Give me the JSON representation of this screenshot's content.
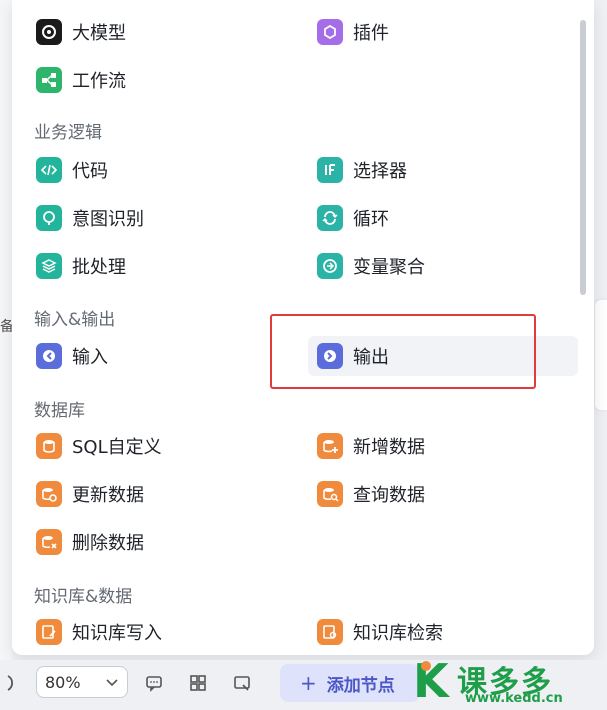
{
  "background": {
    "left_clipped_text": "备"
  },
  "menu": {
    "top_items": [
      {
        "label": "大模型",
        "icon": "llm-icon"
      },
      {
        "label": "插件",
        "icon": "plugin-icon"
      },
      {
        "label": "工作流",
        "icon": "workflow-icon"
      }
    ],
    "sections": {
      "business_logic": {
        "title": "业务逻辑",
        "items": [
          {
            "label": "代码",
            "icon": "code-icon"
          },
          {
            "label": "选择器",
            "icon": "if-selector-icon"
          },
          {
            "label": "意图识别",
            "icon": "intent-icon"
          },
          {
            "label": "循环",
            "icon": "loop-icon"
          },
          {
            "label": "批处理",
            "icon": "batch-icon"
          },
          {
            "label": "变量聚合",
            "icon": "variable-merge-icon"
          }
        ]
      },
      "io": {
        "title": "输入&输出",
        "items": [
          {
            "label": "输入",
            "icon": "input-icon"
          },
          {
            "label": "输出",
            "icon": "output-icon"
          }
        ]
      },
      "database": {
        "title": "数据库",
        "items": [
          {
            "label": "SQL自定义",
            "icon": "sql-icon"
          },
          {
            "label": "新增数据",
            "icon": "db-add-icon"
          },
          {
            "label": "更新数据",
            "icon": "db-update-icon"
          },
          {
            "label": "查询数据",
            "icon": "db-query-icon"
          },
          {
            "label": "删除数据",
            "icon": "db-delete-icon"
          }
        ]
      },
      "knowledge": {
        "title": "知识库&数据",
        "items": [
          {
            "label": "知识库写入",
            "icon": "kb-write-icon"
          },
          {
            "label": "知识库检索",
            "icon": "kb-search-icon"
          }
        ]
      }
    },
    "colors": {
      "highlight_border": "#e23b3b",
      "green": "#2db56c",
      "purple": "#a56ee8",
      "indigo": "#5b6cdb",
      "orange": "#f08b3d"
    }
  },
  "toolbar": {
    "zoom_value": "80%",
    "add_node_label": "添加节点"
  },
  "watermark": {
    "brand": "课多多",
    "url": "www.kedd.cn"
  }
}
